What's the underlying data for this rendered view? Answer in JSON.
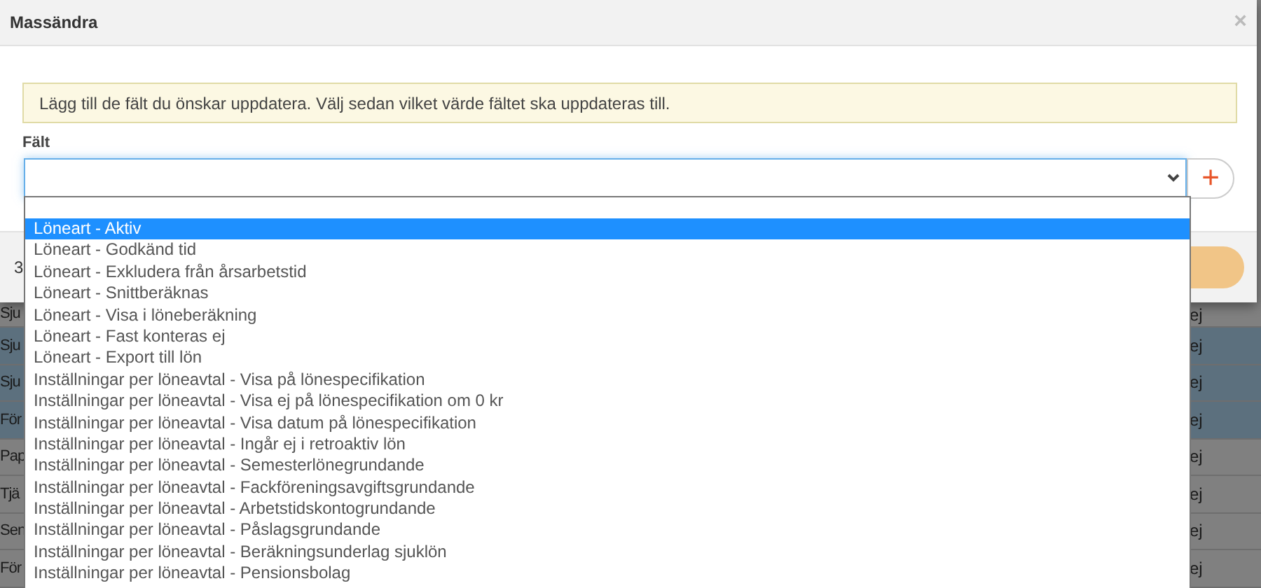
{
  "dialog": {
    "title": "Massändra",
    "close": "×",
    "notice": "Lägg till de fält du önskar uppdatera. Välj sedan vilket värde fältet ska uppdateras till.",
    "field_label": "Fält",
    "add": "+",
    "footer_text": "3"
  },
  "dropdown": {
    "options": [
      {
        "label": "Löneart - Aktiv",
        "selected": true
      },
      {
        "label": "Löneart - Godkänd tid",
        "selected": false
      },
      {
        "label": "Löneart - Exkludera från årsarbetstid",
        "selected": false
      },
      {
        "label": "Löneart - Snittberäknas",
        "selected": false
      },
      {
        "label": "Löneart - Visa i löneberäkning",
        "selected": false
      },
      {
        "label": "Löneart - Fast konteras ej",
        "selected": false
      },
      {
        "label": "Löneart - Export till lön",
        "selected": false
      },
      {
        "label": "Inställningar per löneavtal - Visa på lönespecifikation",
        "selected": false
      },
      {
        "label": "Inställningar per löneavtal - Visa ej på lönespecifikation om 0 kr",
        "selected": false
      },
      {
        "label": "Inställningar per löneavtal - Visa datum på lönespecifikation",
        "selected": false
      },
      {
        "label": "Inställningar per löneavtal - Ingår ej i retroaktiv lön",
        "selected": false
      },
      {
        "label": "Inställningar per löneavtal - Semesterlönegrundande",
        "selected": false
      },
      {
        "label": "Inställningar per löneavtal - Fackföreningsavgiftsgrundande",
        "selected": false
      },
      {
        "label": "Inställningar per löneavtal - Arbetstidskontogrundande",
        "selected": false
      },
      {
        "label": "Inställningar per löneavtal - Påslagsgrundande",
        "selected": false
      },
      {
        "label": "Inställningar per löneavtal - Beräkningsunderlag sjuklön",
        "selected": false
      },
      {
        "label": "Inställningar per löneavtal - Pensionsbolag",
        "selected": false
      }
    ]
  },
  "background_table": {
    "rows": [
      {
        "column_1": "Sju",
        "column_2": "ej",
        "selected": false
      },
      {
        "column_1": "Sju",
        "column_2": "ej",
        "selected": true
      },
      {
        "column_1": "Sju",
        "column_2": "ej",
        "selected": true
      },
      {
        "column_1": "För",
        "column_2": "ej",
        "selected": true
      },
      {
        "column_1": "Pap",
        "column_2": "ej",
        "selected": false
      },
      {
        "column_1": "Tjä",
        "column_2": "ej",
        "selected": false
      },
      {
        "column_1": "Sen",
        "column_2": "ej",
        "selected": false
      },
      {
        "column_1": "För",
        "column_2": "ej",
        "selected": false
      }
    ]
  }
}
